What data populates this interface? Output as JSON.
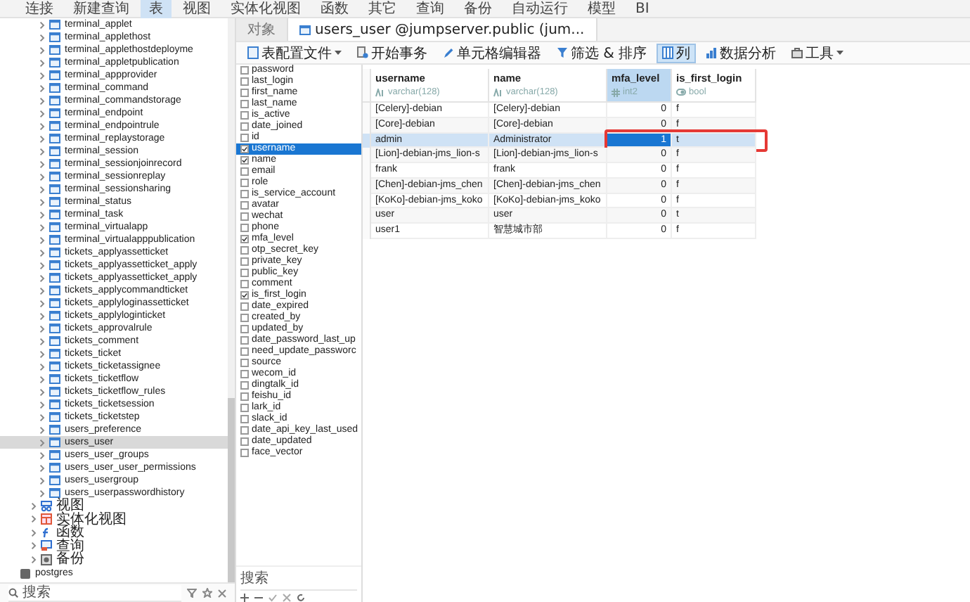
{
  "menu": [
    {
      "label": "连接",
      "selected": false
    },
    {
      "label": "新建查询",
      "selected": false
    },
    {
      "label": "表",
      "selected": true
    },
    {
      "label": "视图",
      "selected": false
    },
    {
      "label": "实体化视图",
      "selected": false
    },
    {
      "label": "函数",
      "selected": false
    },
    {
      "label": "其它",
      "selected": false
    },
    {
      "label": "查询",
      "selected": false
    },
    {
      "label": "备份",
      "selected": false
    },
    {
      "label": "自动运行",
      "selected": false
    },
    {
      "label": "模型",
      "selected": false
    },
    {
      "label": "BI",
      "selected": false
    }
  ],
  "tree": {
    "tables": [
      {
        "label": "terminal_applet",
        "selected": false
      },
      {
        "label": "terminal_applethost",
        "selected": false
      },
      {
        "label": "terminal_applethostdeployme",
        "selected": false
      },
      {
        "label": "terminal_appletpublication",
        "selected": false
      },
      {
        "label": "terminal_appprovider",
        "selected": false
      },
      {
        "label": "terminal_command",
        "selected": false
      },
      {
        "label": "terminal_commandstorage",
        "selected": false
      },
      {
        "label": "terminal_endpoint",
        "selected": false
      },
      {
        "label": "terminal_endpointrule",
        "selected": false
      },
      {
        "label": "terminal_replaystorage",
        "selected": false
      },
      {
        "label": "terminal_session",
        "selected": false
      },
      {
        "label": "terminal_sessionjoinrecord",
        "selected": false
      },
      {
        "label": "terminal_sessionreplay",
        "selected": false
      },
      {
        "label": "terminal_sessionsharing",
        "selected": false
      },
      {
        "label": "terminal_status",
        "selected": false
      },
      {
        "label": "terminal_task",
        "selected": false
      },
      {
        "label": "terminal_virtualapp",
        "selected": false
      },
      {
        "label": "terminal_virtualapppublication",
        "selected": false
      },
      {
        "label": "tickets_applyassetticket",
        "selected": false
      },
      {
        "label": "tickets_applyassetticket_apply",
        "selected": false
      },
      {
        "label": "tickets_applyassetticket_apply",
        "selected": false
      },
      {
        "label": "tickets_applycommandticket",
        "selected": false
      },
      {
        "label": "tickets_applyloginassetticket",
        "selected": false
      },
      {
        "label": "tickets_applyloginticket",
        "selected": false
      },
      {
        "label": "tickets_approvalrule",
        "selected": false
      },
      {
        "label": "tickets_comment",
        "selected": false
      },
      {
        "label": "tickets_ticket",
        "selected": false
      },
      {
        "label": "tickets_ticketassignee",
        "selected": false
      },
      {
        "label": "tickets_ticketflow",
        "selected": false
      },
      {
        "label": "tickets_ticketflow_rules",
        "selected": false
      },
      {
        "label": "tickets_ticketsession",
        "selected": false
      },
      {
        "label": "tickets_ticketstep",
        "selected": false
      },
      {
        "label": "users_preference",
        "selected": false
      },
      {
        "label": "users_user",
        "selected": true
      },
      {
        "label": "users_user_groups",
        "selected": false
      },
      {
        "label": "users_user_user_permissions",
        "selected": false
      },
      {
        "label": "users_usergroup",
        "selected": false
      },
      {
        "label": "users_userpasswordhistory",
        "selected": false
      }
    ],
    "folders": [
      {
        "label": "视图",
        "kind": "view"
      },
      {
        "label": "实体化视图",
        "kind": "matview"
      },
      {
        "label": "函数",
        "kind": "function"
      },
      {
        "label": "查询",
        "kind": "query"
      },
      {
        "label": "备份",
        "kind": "backup"
      }
    ],
    "database": "postgres",
    "search_placeholder": "搜索"
  },
  "tabs": [
    {
      "label": "对象",
      "selected": false
    },
    {
      "label": "users_user @jumpserver.public (jum...",
      "selected": true
    }
  ],
  "toolbar": [
    {
      "label": "表配置文件",
      "kind": "profile",
      "dropdown": true,
      "selected": false
    },
    {
      "label": "开始事务",
      "kind": "transaction",
      "dropdown": false,
      "selected": false
    },
    {
      "label": "单元格编辑器",
      "kind": "editor",
      "dropdown": false,
      "selected": false
    },
    {
      "label": "筛选 & 排序",
      "kind": "filter",
      "dropdown": false,
      "selected": false
    },
    {
      "label": "列",
      "kind": "columns",
      "dropdown": false,
      "selected": true
    },
    {
      "label": "数据分析",
      "kind": "analysis",
      "dropdown": false,
      "selected": false
    },
    {
      "label": "工具",
      "kind": "tools",
      "dropdown": true,
      "selected": false
    }
  ],
  "column_list": {
    "items": [
      {
        "label": "password",
        "checked": false,
        "selected": false
      },
      {
        "label": "last_login",
        "checked": false,
        "selected": false
      },
      {
        "label": "first_name",
        "checked": false,
        "selected": false
      },
      {
        "label": "last_name",
        "checked": false,
        "selected": false
      },
      {
        "label": "is_active",
        "checked": false,
        "selected": false
      },
      {
        "label": "date_joined",
        "checked": false,
        "selected": false
      },
      {
        "label": "id",
        "checked": false,
        "selected": false
      },
      {
        "label": "username",
        "checked": true,
        "selected": true
      },
      {
        "label": "name",
        "checked": true,
        "selected": false
      },
      {
        "label": "email",
        "checked": false,
        "selected": false
      },
      {
        "label": "role",
        "checked": false,
        "selected": false
      },
      {
        "label": "is_service_account",
        "checked": false,
        "selected": false
      },
      {
        "label": "avatar",
        "checked": false,
        "selected": false
      },
      {
        "label": "wechat",
        "checked": false,
        "selected": false
      },
      {
        "label": "phone",
        "checked": false,
        "selected": false
      },
      {
        "label": "mfa_level",
        "checked": true,
        "selected": false
      },
      {
        "label": "otp_secret_key",
        "checked": false,
        "selected": false
      },
      {
        "label": "private_key",
        "checked": false,
        "selected": false
      },
      {
        "label": "public_key",
        "checked": false,
        "selected": false
      },
      {
        "label": "comment",
        "checked": false,
        "selected": false
      },
      {
        "label": "is_first_login",
        "checked": true,
        "selected": false
      },
      {
        "label": "date_expired",
        "checked": false,
        "selected": false
      },
      {
        "label": "created_by",
        "checked": false,
        "selected": false
      },
      {
        "label": "updated_by",
        "checked": false,
        "selected": false
      },
      {
        "label": "date_password_last_up",
        "checked": false,
        "selected": false
      },
      {
        "label": "need_update_passworc",
        "checked": false,
        "selected": false
      },
      {
        "label": "source",
        "checked": false,
        "selected": false
      },
      {
        "label": "wecom_id",
        "checked": false,
        "selected": false
      },
      {
        "label": "dingtalk_id",
        "checked": false,
        "selected": false
      },
      {
        "label": "feishu_id",
        "checked": false,
        "selected": false
      },
      {
        "label": "lark_id",
        "checked": false,
        "selected": false
      },
      {
        "label": "slack_id",
        "checked": false,
        "selected": false
      },
      {
        "label": "date_api_key_last_used",
        "checked": false,
        "selected": false
      },
      {
        "label": "date_updated",
        "checked": false,
        "selected": false
      },
      {
        "label": "face_vector",
        "checked": false,
        "selected": false
      }
    ],
    "search_placeholder": "搜索"
  },
  "table": {
    "columns": [
      {
        "name": "username",
        "type": "varchar(128)",
        "kind": "text",
        "selected": false
      },
      {
        "name": "name",
        "type": "varchar(128)",
        "kind": "text",
        "selected": false
      },
      {
        "name": "mfa_level",
        "type": "int2",
        "kind": "number",
        "selected": true
      },
      {
        "name": "is_first_login",
        "type": "bool",
        "kind": "bool",
        "selected": false
      }
    ],
    "rows": [
      {
        "cells": [
          "[Celery]-debian",
          "[Celery]-debian",
          "0",
          "f"
        ],
        "selected": false,
        "annotated": false
      },
      {
        "cells": [
          "[Core]-debian",
          "[Core]-debian",
          "0",
          "f"
        ],
        "selected": false,
        "annotated": false
      },
      {
        "cells": [
          "admin",
          "Administrator",
          "1",
          "t"
        ],
        "selected": true,
        "annotated": true
      },
      {
        "cells": [
          "[Lion]-debian-jms_lion-s",
          "[Lion]-debian-jms_lion-s",
          "0",
          "f"
        ],
        "selected": false,
        "annotated": false
      },
      {
        "cells": [
          "frank",
          "frank",
          "0",
          "f"
        ],
        "selected": false,
        "annotated": false
      },
      {
        "cells": [
          "[Chen]-debian-jms_chen",
          "[Chen]-debian-jms_chen",
          "0",
          "f"
        ],
        "selected": false,
        "annotated": false
      },
      {
        "cells": [
          "[KoKo]-debian-jms_koko",
          "[KoKo]-debian-jms_koko",
          "0",
          "f"
        ],
        "selected": false,
        "annotated": false
      },
      {
        "cells": [
          "user",
          "user",
          "0",
          "t"
        ],
        "selected": false,
        "annotated": false
      },
      {
        "cells": [
          "user1",
          "智慧城市部",
          "0",
          "f"
        ],
        "selected": false,
        "annotated": false
      }
    ]
  }
}
